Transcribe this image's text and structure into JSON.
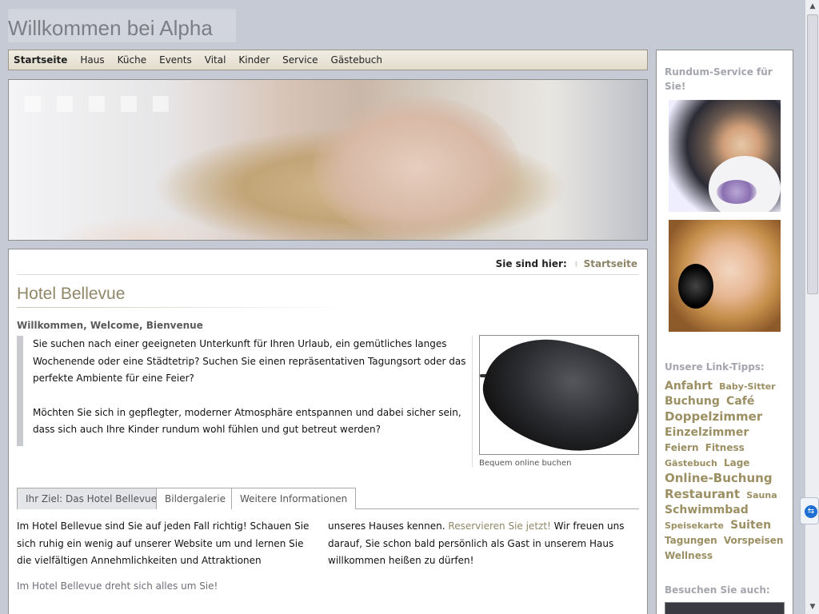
{
  "site": {
    "title": "Willkommen bei Alpha"
  },
  "nav": {
    "items": [
      "Startseite",
      "Haus",
      "Küche",
      "Events",
      "Vital",
      "Kinder",
      "Service",
      "Gästebuch"
    ]
  },
  "breadcrumb": {
    "label": "Sie sind hier:",
    "current": "Startseite"
  },
  "content": {
    "heading": "Hotel Bellevue",
    "welcome": "Willkommen, Welcome, Bienvenue",
    "intro_p1": "Sie suchen nach einer geeigneten Unterkunft für Ihren Urlaub, ein gemütliches langes Wochenende oder eine Städtetrip? Suchen Sie einen repräsentativen Tagungsort oder das perfekte Ambiente für eine Feier?",
    "intro_p2": "Möchten Sie sich in gepflegter, moderner Atmosphäre entspannen und dabei sicher sein, dass sich auch Ihre Kinder rundum wohl fühlen und gut betreut werden?",
    "image_caption": "Bequem online buchen",
    "tabs": [
      "Ihr Ziel: Das Hotel Bellevue",
      "Bildergalerie",
      "Weitere Informationen"
    ],
    "col1": "Im Hotel Bellevue sind Sie auf jeden Fall richtig! Schauen Sie sich ruhig ein wenig auf unserer Website um und lernen Sie die vielfältigen Annehmlichkeiten und Attraktionen",
    "col2_start": "unseres Hauses kennen.",
    "col2_link": "Reservieren Sie jetzt!",
    "col2_end": "Wir freuen uns darauf, Sie schon bald persönlich als Gast in unserem Haus willkommen heißen zu dürfen!",
    "tagline": "Im Hotel Bellevue dreht sich alles um Sie!"
  },
  "sidebar": {
    "service_heading": "Rundum-Service für Sie!",
    "links_heading": "Unsere Link-Tipps:",
    "tags": [
      {
        "label": "Anfahrt",
        "size": 3
      },
      {
        "label": "Baby-Sitter",
        "size": 0
      },
      {
        "label": "Buchung",
        "size": 3
      },
      {
        "label": "Café",
        "size": 3
      },
      {
        "label": "Doppelzimmer",
        "size": 4
      },
      {
        "label": "Einzelzimmer",
        "size": 3
      },
      {
        "label": "Feiern",
        "size": 1
      },
      {
        "label": "Fitness",
        "size": 1
      },
      {
        "label": "Gästebuch",
        "size": 0
      },
      {
        "label": "Lage",
        "size": 1
      },
      {
        "label": "Online-Buchung",
        "size": 4
      },
      {
        "label": "Restaurant",
        "size": 4
      },
      {
        "label": "Sauna",
        "size": 0
      },
      {
        "label": "Schwimmbad",
        "size": 3
      },
      {
        "label": "Speisekarte",
        "size": 0
      },
      {
        "label": "Suiten",
        "size": 3
      },
      {
        "label": "Tagungen",
        "size": 1
      },
      {
        "label": "Vorspeisen",
        "size": 1
      },
      {
        "label": "Wellness",
        "size": 1
      }
    ],
    "visit_heading": "Besuchen Sie auch:"
  },
  "colors": {
    "accent": "#8f8768",
    "tag": "#9b8f63",
    "page_bg": "#c6cad5"
  }
}
